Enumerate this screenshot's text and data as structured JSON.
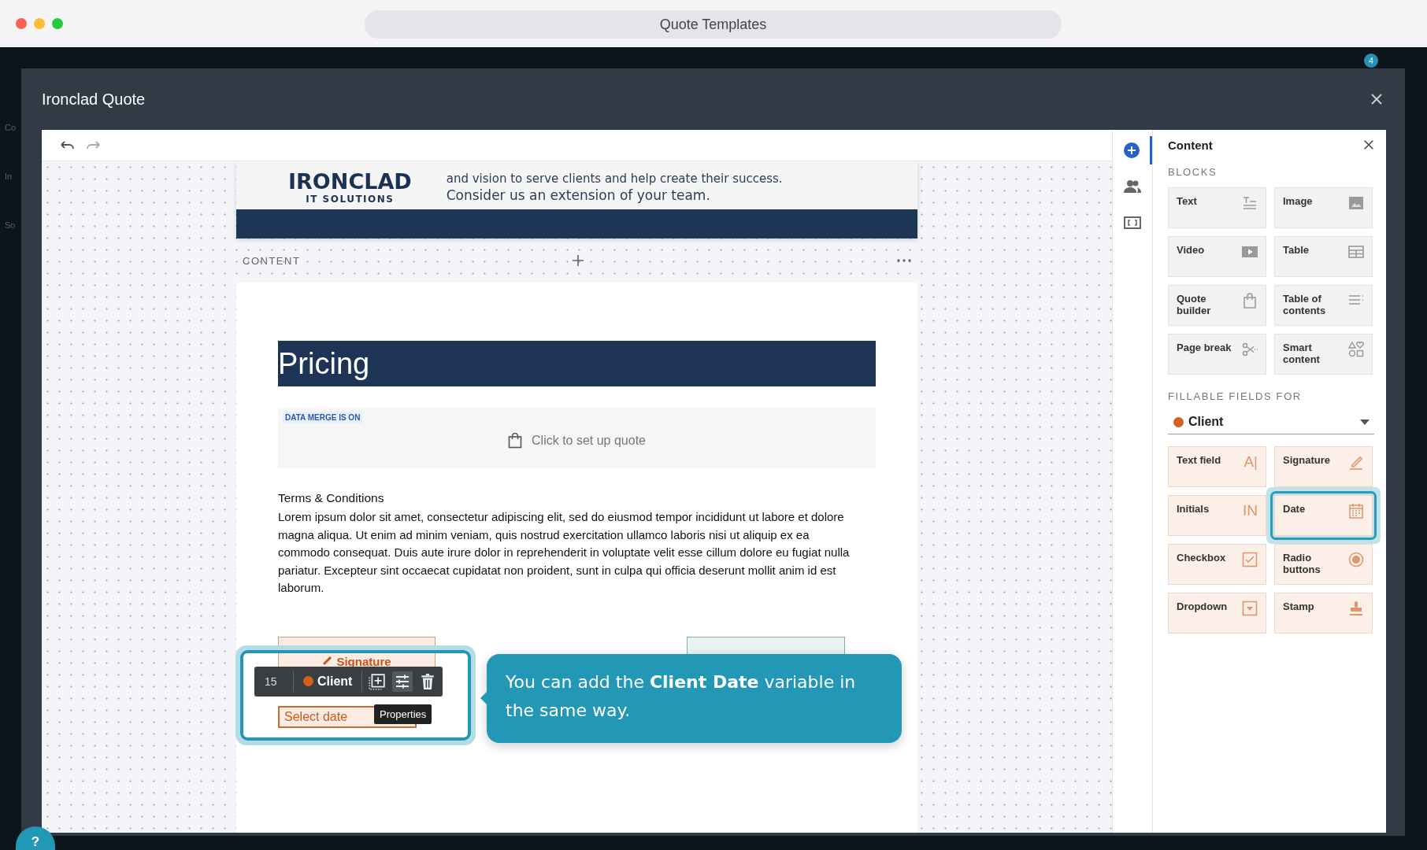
{
  "browser": {
    "title": "Quote Templates"
  },
  "background": {
    "side_labels": [
      "Co",
      "In",
      "So"
    ],
    "notification_count": "4",
    "help": "?"
  },
  "modal": {
    "title": "Ironclad Quote"
  },
  "document": {
    "logo": {
      "name": "IRONCLAD",
      "tagline": "IT SOLUTIONS"
    },
    "intro": [
      "and vision to serve clients and help create their success.",
      "Consider us an extension of your team."
    ],
    "section_label": "CONTENT",
    "pricing_title": "Pricing",
    "quote_block": {
      "badge": "DATA MERGE IS ON",
      "action": "Click to set up quote"
    },
    "terms": {
      "heading": "Terms & Conditions",
      "body": "Lorem ipsum dolor sit amet, consectetur adipiscing elit, sed do eiusmod tempor incididunt ut labore et dolore magna aliqua. Ut enim ad minim veniam, quis nostrud exercitation ullamco laboris nisi ut aliquip ex ea commodo consequat. Duis aute irure dolor in reprehenderit in voluptate velit esse cillum dolore eu fugiat nulla pariatur. Excepteur sint occaecat cupidatat non proident, sunt in culpa qui officia deserunt mollit anim id est laborum."
    },
    "signature_field": {
      "label": "Signature"
    },
    "date_field": {
      "placeholder": "Select date"
    },
    "field_toolbar": {
      "number": "15",
      "recipient": "Client",
      "color": "#d4601c",
      "tooltip": "Properties"
    }
  },
  "callout": {
    "text": "You can add the **Client Date** variable in the same way."
  },
  "rail": [
    {
      "selected": true
    },
    {
      "selected": false
    },
    {
      "selected": false
    }
  ],
  "panel": {
    "title": "Content",
    "blocks_label": "BLOCKS",
    "blocks": [
      {
        "label": "Text"
      },
      {
        "label": "Image"
      },
      {
        "label": "Video"
      },
      {
        "label": "Table"
      },
      {
        "label": "Quote builder"
      },
      {
        "label": "Table of contents"
      },
      {
        "label": "Page break"
      },
      {
        "label": "Smart content"
      }
    ],
    "fields_label": "FILLABLE FIELDS FOR",
    "recipient": {
      "name": "Client",
      "color": "#d4601c"
    },
    "fields": [
      {
        "label": "Text field",
        "icon_text": "A|",
        "selected": false
      },
      {
        "label": "Signature",
        "selected": false
      },
      {
        "label": "Initials",
        "icon_text": "IN",
        "selected": false
      },
      {
        "label": "Date",
        "selected": true
      },
      {
        "label": "Checkbox",
        "selected": false
      },
      {
        "label": "Radio buttons",
        "selected": false
      },
      {
        "label": "Dropdown",
        "selected": false
      },
      {
        "label": "Stamp",
        "selected": false
      }
    ]
  }
}
